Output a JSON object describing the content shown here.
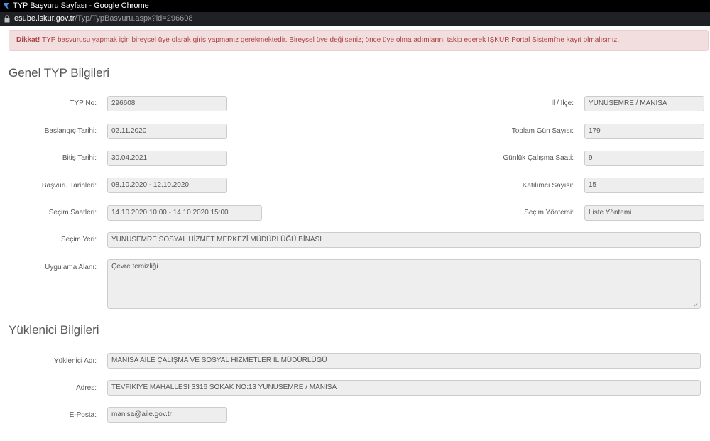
{
  "window": {
    "title": "TYP Başvuru Sayfası - Google Chrome",
    "url_host": "esube.iskur.gov.tr",
    "url_path": "/Typ/TypBasvuru.aspx?id=296608"
  },
  "alert": {
    "strong": "Dikkat!",
    "text": " TYP başvurusu yapmak için bireysel üye olarak giriş yapmanız gerekmektedir. Bireysel üye değilseniz; önce üye olma adımlarını takip ederek İŞKUR Portal Sistemi'ne kayıt olmalısınız."
  },
  "genel": {
    "title": "Genel TYP Bilgileri",
    "typ_no": {
      "label": "TYP No:",
      "value": "296608"
    },
    "il_ilce": {
      "label": "İl / İlçe:",
      "value": "YUNUSEMRE / MANİSA"
    },
    "baslangic": {
      "label": "Başlangıç Tarihi:",
      "value": "02.11.2020"
    },
    "toplam_gun": {
      "label": "Toplam Gün Sayısı:",
      "value": "179"
    },
    "bitis": {
      "label": "Bitiş Tarihi:",
      "value": "30.04.2021"
    },
    "gunluk_saat": {
      "label": "Günlük Çalışma Saati:",
      "value": "9"
    },
    "basvuru_tarihleri": {
      "label": "Başvuru Tarihleri:",
      "value": "08.10.2020 - 12.10.2020"
    },
    "katilimci": {
      "label": "Katılımcı Sayısı:",
      "value": "15"
    },
    "secim_saatleri": {
      "label": "Seçim Saatleri:",
      "value": "14.10.2020 10:00 - 14.10.2020 15:00"
    },
    "secim_yontemi": {
      "label": "Seçim Yöntemi:",
      "value": "Liste Yöntemi"
    },
    "secim_yeri": {
      "label": "Seçim Yeri:",
      "value": "YUNUSEMRE SOSYAL HİZMET MERKEZİ MÜDÜRLÜĞÜ BİNASI"
    },
    "uygulama_alani": {
      "label": "Uygulama Alanı:",
      "value": "Çevre temizliği"
    }
  },
  "yuklenici": {
    "title": "Yüklenici Bilgileri",
    "adi": {
      "label": "Yüklenici Adı:",
      "value": "MANİSA AİLE ÇALIŞMA VE SOSYAL HİZMETLER İL MÜDÜRLÜĞÜ"
    },
    "adres": {
      "label": "Adres:",
      "value": "TEVFİKİYE MAHALLESİ 3316 SOKAK NO:13 YUNUSEMRE / MANİSA"
    },
    "eposta": {
      "label": "E-Posta:",
      "value": "manisa@aile.gov.tr"
    }
  }
}
